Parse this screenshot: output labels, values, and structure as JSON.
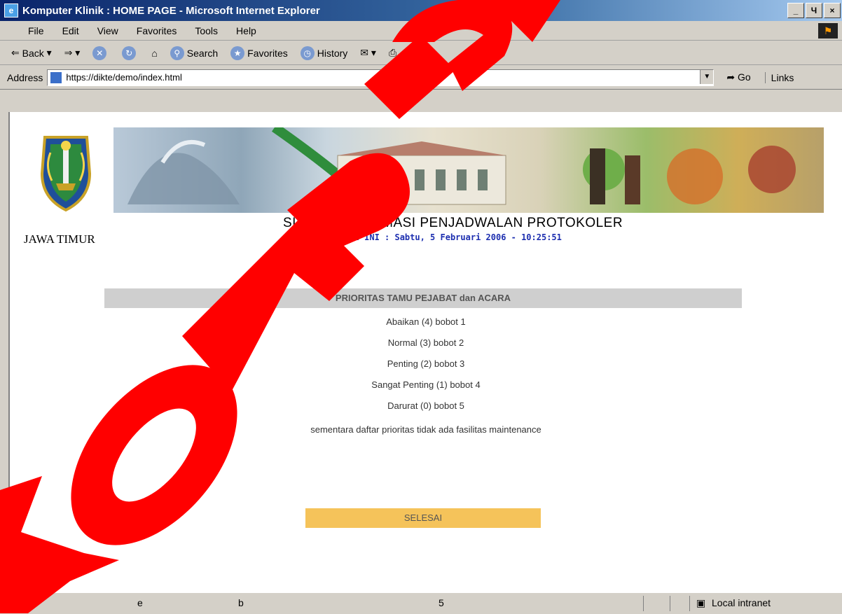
{
  "window": {
    "title": "Komputer Klinik : HOME PAGE - Microsoft Internet Explorer",
    "controls": [
      "_",
      "Ч",
      "×"
    ]
  },
  "menu": [
    "File",
    "Edit",
    "View",
    "Favorites",
    "Tools",
    "Help"
  ],
  "toolbar": {
    "back": "Back",
    "search": "Search",
    "favorites": "Favorites",
    "history": "History"
  },
  "address": {
    "label": "Address",
    "url": "https://dikte/demo/index.html",
    "go": "Go",
    "links": "Links"
  },
  "page": {
    "region_label": "JAWA TIMUR",
    "system_title": "SISTEM INFORMASI PENJADWALAN PROTOKOLER",
    "today": "HARI INI :  Sabtu, 5 Februari 2006 - 10:25:51",
    "priority_header": "PRIORITAS TAMU PEJABAT dan ACARA",
    "priorities": [
      "Abaikan (4) bobot 1",
      "Normal (3) bobot 2",
      "Penting (2) bobot 3",
      "Sangat Penting (1) bobot 4",
      "Darurat (0) bobot 5"
    ],
    "note": "sementara daftar prioritas tidak ada fasilitas maintenance",
    "finish_button": "SELESAI"
  },
  "statusbar": {
    "cells": [
      "e",
      "b",
      "5"
    ],
    "zone": "Local intranet"
  },
  "watermark": "KOMPUS",
  "colors": {
    "title_gradient_start": "#0a246a",
    "priority_header_bg": "#cfcfcf",
    "finish_button_bg": "#f5c35a",
    "today_text": "#1d2fb0",
    "watermark": "#ff0000"
  }
}
